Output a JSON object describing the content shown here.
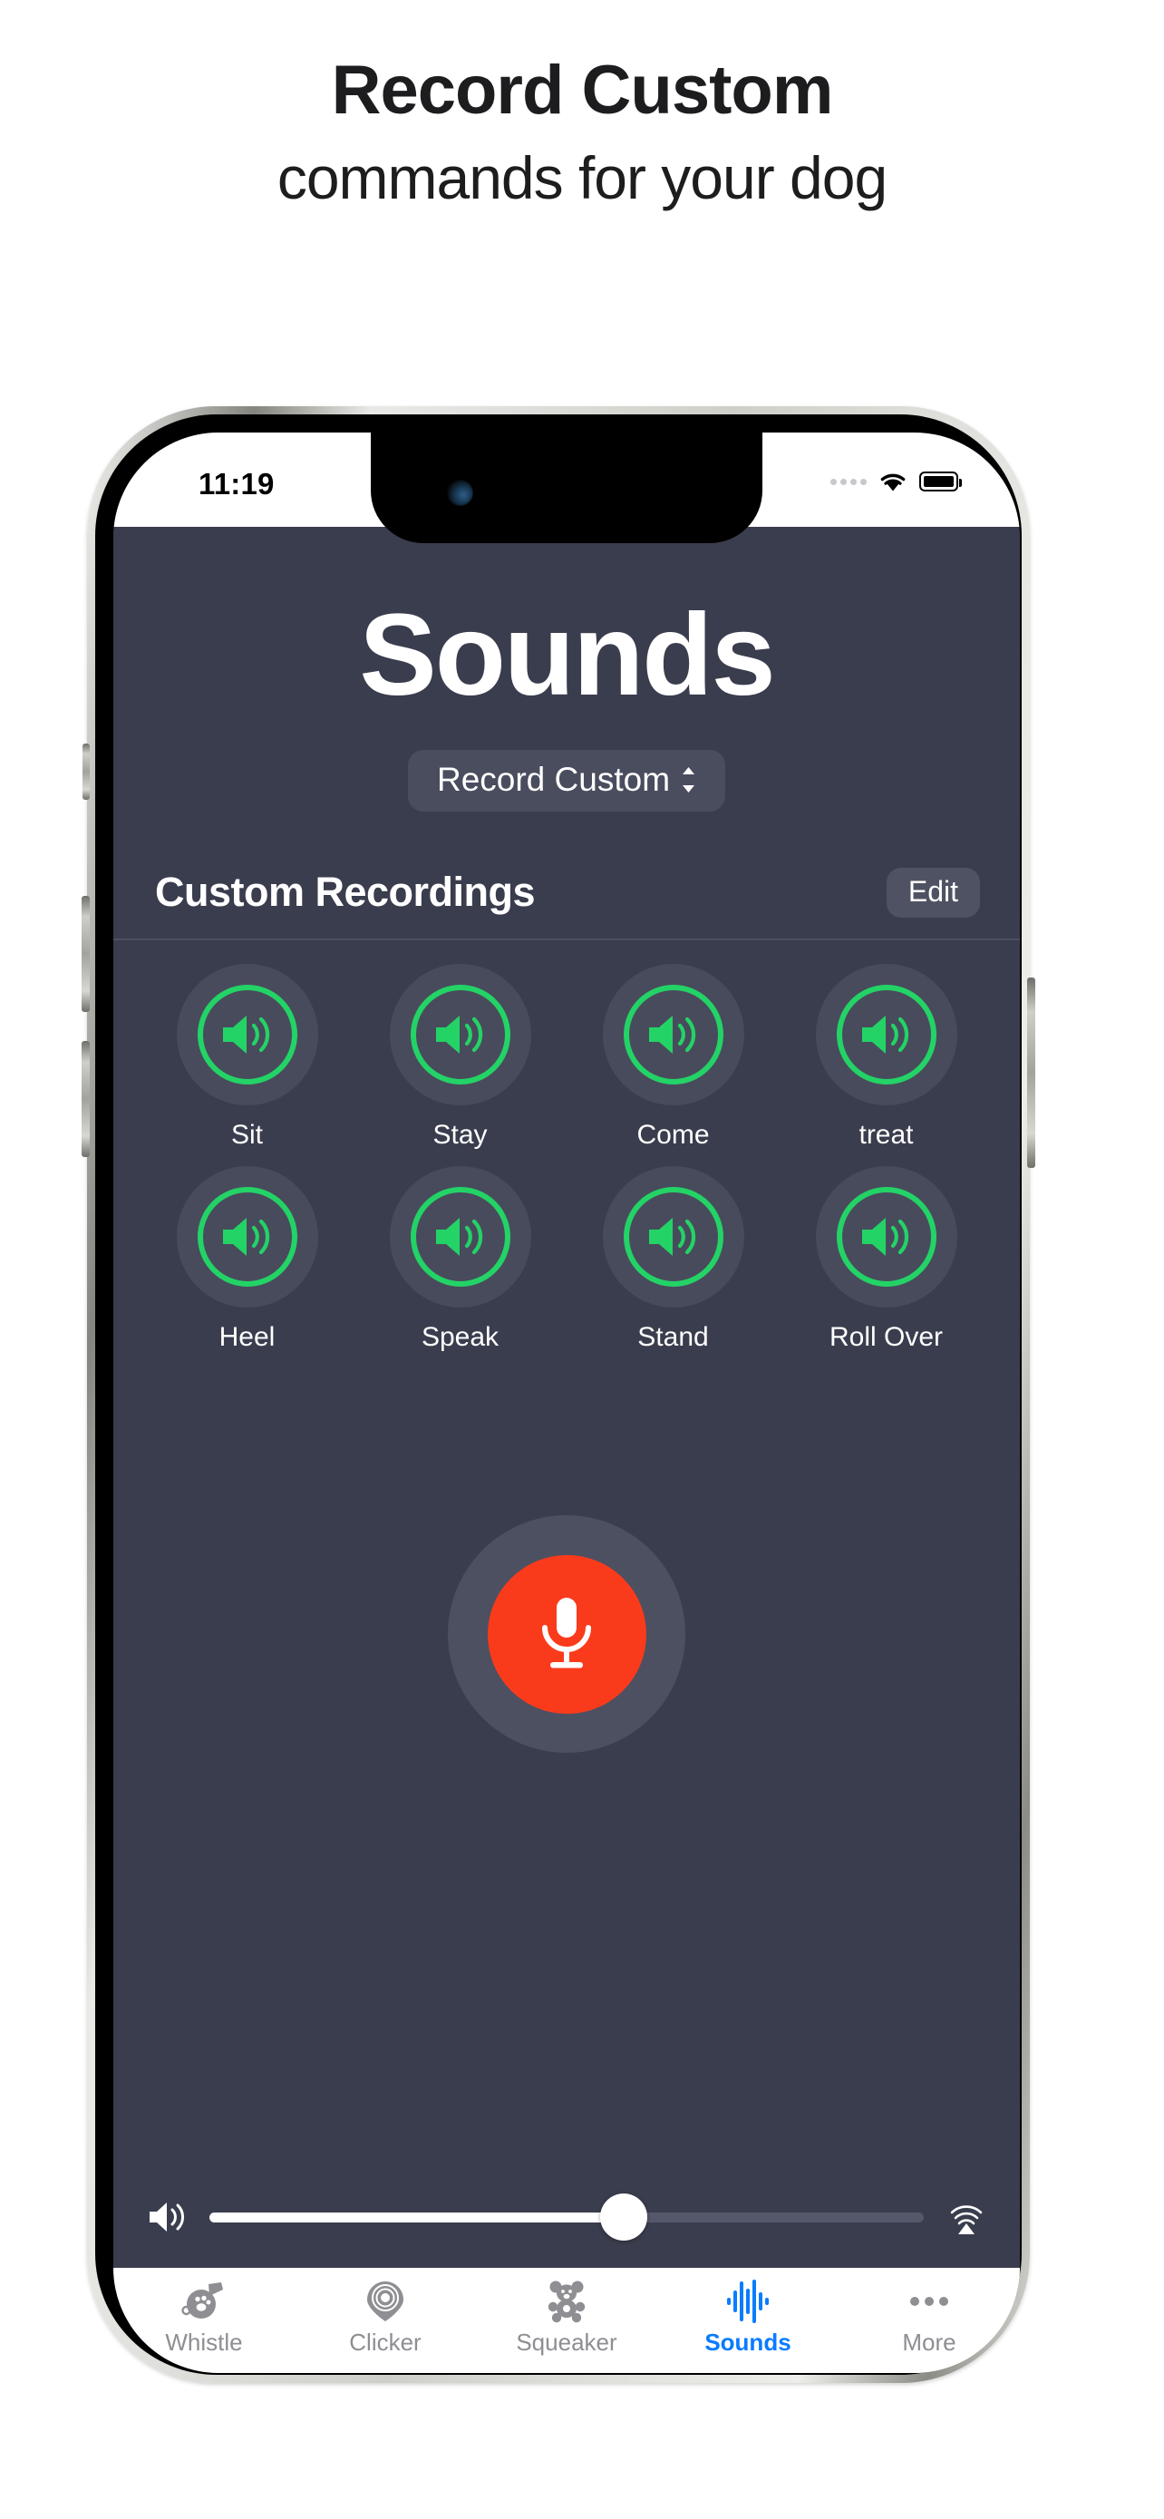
{
  "promo": {
    "title": "Record Custom",
    "subtitle": "commands for your dog"
  },
  "statusbar": {
    "time": "11:19",
    "cellular_icon": "cellular-dots-icon",
    "wifi_icon": "wifi-icon",
    "battery_icon": "battery-full-icon"
  },
  "app": {
    "nav_title": "Sounds",
    "mode_picker": {
      "label": "Record Custom",
      "icon": "chevron-up-down-icon"
    },
    "section": {
      "title": "Custom Recordings",
      "edit_label": "Edit"
    },
    "sounds": [
      {
        "label": "Sit",
        "icon": "speaker-wave-icon"
      },
      {
        "label": "Stay",
        "icon": "speaker-wave-icon"
      },
      {
        "label": "Come",
        "icon": "speaker-wave-icon"
      },
      {
        "label": "treat",
        "icon": "speaker-wave-icon"
      },
      {
        "label": "Heel",
        "icon": "speaker-wave-icon"
      },
      {
        "label": "Speak",
        "icon": "speaker-wave-icon"
      },
      {
        "label": "Stand",
        "icon": "speaker-wave-icon"
      },
      {
        "label": "Roll Over",
        "icon": "speaker-wave-icon"
      }
    ],
    "record_button": {
      "icon": "microphone-icon"
    },
    "volume": {
      "left_icon": "speaker-wave-icon",
      "right_icon": "airplay-audio-icon",
      "value_percent": 58
    },
    "tabs": [
      {
        "label": "Whistle",
        "icon": "whistle-paw-icon",
        "active": false
      },
      {
        "label": "Clicker",
        "icon": "clicker-pin-icon",
        "active": false
      },
      {
        "label": "Squeaker",
        "icon": "teddy-bear-icon",
        "active": false
      },
      {
        "label": "Sounds",
        "icon": "waveform-icon",
        "active": true
      },
      {
        "label": "More",
        "icon": "ellipsis-icon",
        "active": false
      }
    ]
  },
  "colors": {
    "screen_background": "#3a3d4d",
    "accent_green": "#23d366",
    "record_red": "#fa3b1b",
    "tab_active_blue": "#0a7cff",
    "tab_inactive_gray": "#8e8e93"
  }
}
